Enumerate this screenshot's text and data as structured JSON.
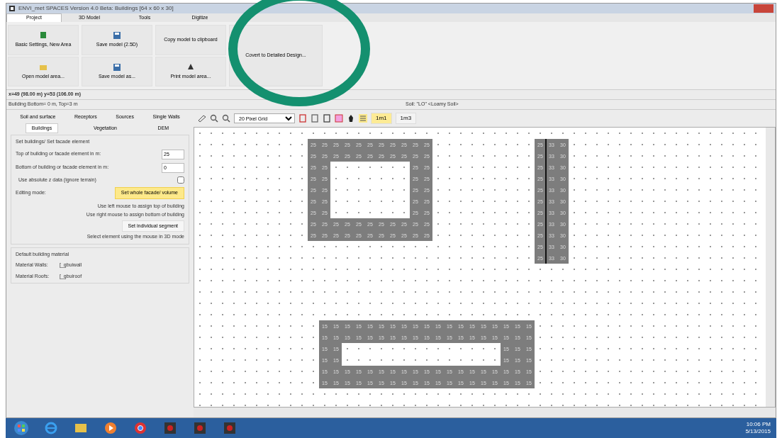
{
  "window": {
    "title": "ENVI_met SPACES Version 4.0 Beta: Buildings [64 x 60 x 30]"
  },
  "menu_tabs": [
    {
      "label": "Project",
      "selected": true
    },
    {
      "label": "3D Model",
      "selected": false
    },
    {
      "label": "Tools",
      "selected": false
    },
    {
      "label": "Digitize",
      "selected": false
    }
  ],
  "ribbon": [
    {
      "label": "Basic Settings, New Area"
    },
    {
      "label": "Open model area..."
    },
    {
      "label": "Save model (2.5D)"
    },
    {
      "label": "Save model as..."
    },
    {
      "label": "Copy model to clipboard"
    },
    {
      "label": "Print model area..."
    },
    {
      "label": "Covert to Detailed Design..."
    }
  ],
  "coordinates": "x=49 (98.00 m) y=53 (106.00 m)",
  "status": {
    "building": "Building Bottom= 0 m, Top=3 m",
    "soil": "Soil: \"LO\" <Loamy Soil>"
  },
  "panel_tabs": [
    [
      {
        "label": "Soil and surface",
        "selected": false
      },
      {
        "label": "Receptors",
        "selected": false
      },
      {
        "label": "Sources",
        "selected": false
      },
      {
        "label": "Single Walls",
        "selected": false
      }
    ],
    [
      {
        "label": "Buildings",
        "selected": true
      },
      {
        "label": "Vegetation",
        "selected": false
      },
      {
        "label": "DEM",
        "selected": false
      }
    ]
  ],
  "buildings_group": {
    "title": "Set buildings/ Set facade element",
    "top_label": "Top of building or facade element in m:",
    "top_value": "25",
    "bottom_label": "Bottom of building or facade element in m:",
    "bottom_value": "0",
    "absolute_label": "Use absolute z data (ignore terrain)",
    "absolute_checked": false,
    "mode_label": "Editing mode:",
    "mode_button": "Set whole facade/ volume",
    "mode_button_selected": true,
    "hint_left": "Use left mouse to assign top of building",
    "hint_right": "Use right mouse to assign bottom of building",
    "segment_button": "Set individual segment",
    "segment_button_selected": false,
    "hint_3d": "Select element using the mouse in 3D mode"
  },
  "material_group": {
    "title": "Default building material",
    "walls_label": "Material Walls:",
    "walls_value": "[_gbuiwall",
    "roofs_label": "Material Roofs:",
    "roofs_value": "[_gbuiroof"
  },
  "toolbar": {
    "grid_select": "20 Pixel Grid",
    "scale_buttons": [
      {
        "label": "1m1",
        "selected": true
      },
      {
        "label": "1m3",
        "selected": false
      }
    ]
  },
  "buildings": [
    {
      "rows": [
        [
          "25",
          "25",
          "25",
          "25",
          "25",
          "25",
          "25",
          "25",
          "25",
          "25",
          "25"
        ],
        [
          "25",
          "25",
          "25",
          "25",
          "25",
          "25",
          "25",
          "25",
          "25",
          "25",
          "25"
        ],
        [
          "25",
          "25",
          null,
          null,
          null,
          null,
          null,
          null,
          null,
          "25",
          "25"
        ],
        [
          "25",
          "25",
          null,
          null,
          null,
          null,
          null,
          null,
          null,
          "25",
          "25"
        ],
        [
          "25",
          "25",
          null,
          null,
          null,
          null,
          null,
          null,
          null,
          "25",
          "25"
        ],
        [
          "25",
          "25",
          null,
          null,
          null,
          null,
          null,
          null,
          null,
          "25",
          "25"
        ],
        [
          "25",
          "25",
          null,
          null,
          null,
          null,
          null,
          null,
          null,
          "25",
          "25"
        ],
        [
          "25",
          "25",
          "25",
          "25",
          "25",
          "25",
          "25",
          "25",
          "25",
          "25",
          "25"
        ],
        [
          "25",
          "25",
          "25",
          "25",
          "25",
          "25",
          "25",
          "25",
          "25",
          "25",
          "25"
        ]
      ]
    },
    {
      "rows": [
        [
          "25",
          "33",
          "30"
        ],
        [
          "25",
          "33",
          "30"
        ],
        [
          "25",
          "33",
          "30"
        ],
        [
          "25",
          "33",
          "30"
        ],
        [
          "25",
          "33",
          "30"
        ],
        [
          "25",
          "33",
          "30"
        ],
        [
          "25",
          "33",
          "30"
        ],
        [
          "25",
          "33",
          "30"
        ],
        [
          "25",
          "33",
          "30"
        ],
        [
          "25",
          "33",
          "30"
        ],
        [
          "25",
          "33",
          "30"
        ]
      ],
      "divider": true
    },
    {
      "rows": [
        [
          "15",
          "15",
          "15",
          "15",
          "15",
          "15",
          "15",
          "15",
          "15",
          "15",
          "15",
          "15",
          "15",
          "15",
          "15",
          "15",
          "15",
          "15",
          "15"
        ],
        [
          "15",
          "15",
          "15",
          "15",
          "15",
          "15",
          "15",
          "15",
          "15",
          "15",
          "15",
          "15",
          "15",
          "15",
          "15",
          "15",
          "15",
          "15",
          "15"
        ],
        [
          "15",
          "15",
          null,
          null,
          null,
          null,
          null,
          null,
          null,
          null,
          null,
          null,
          null,
          null,
          null,
          null,
          "15",
          "15",
          "15"
        ],
        [
          "15",
          "15",
          null,
          null,
          null,
          null,
          null,
          null,
          null,
          null,
          null,
          null,
          null,
          null,
          null,
          null,
          "15",
          "15",
          "15"
        ],
        [
          "15",
          "15",
          "15",
          "15",
          "15",
          "15",
          "15",
          "15",
          "15",
          "15",
          "15",
          "15",
          "15",
          "15",
          "15",
          "15",
          "15",
          "15",
          "15"
        ],
        [
          "15",
          "15",
          "15",
          "15",
          "15",
          "15",
          "15",
          "15",
          "15",
          "15",
          "15",
          "15",
          "15",
          "15",
          "15",
          "15",
          "15",
          "15",
          "15"
        ]
      ]
    }
  ],
  "taskbar": {
    "time": "10:06 PM",
    "date": "5/13/2015"
  }
}
